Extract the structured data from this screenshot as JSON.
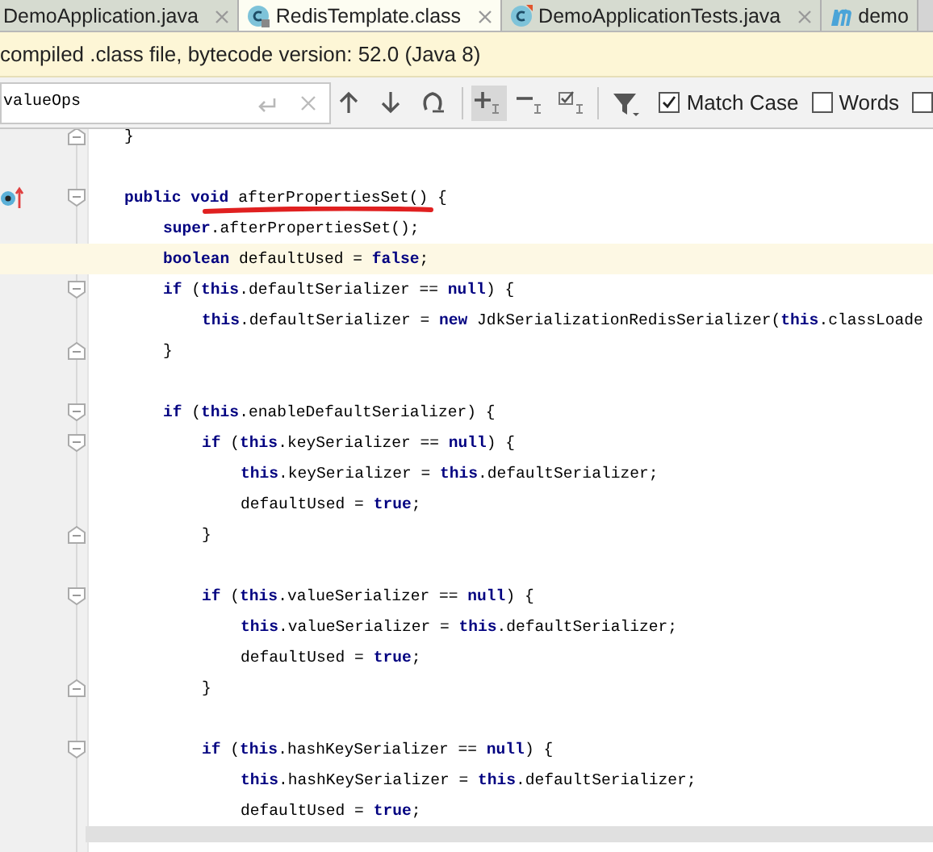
{
  "tabs": [
    {
      "label": "DemoApplication.java",
      "kind": "plain",
      "selected": false,
      "closable": true
    },
    {
      "label": "RedisTemplate.class",
      "kind": "class",
      "selected": true,
      "closable": true
    },
    {
      "label": "DemoApplicationTests.java",
      "kind": "test",
      "selected": false,
      "closable": true
    },
    {
      "label": "demo",
      "kind": "maven",
      "selected": false,
      "closable": false
    }
  ],
  "banner": {
    "text": "compiled .class file, bytecode version: 52.0 (Java 8)"
  },
  "find_bar": {
    "value": "valueOps",
    "tools": [
      {
        "kind": "up",
        "selected": false
      },
      {
        "kind": "down",
        "selected": false
      },
      {
        "kind": "find-all",
        "selected": false
      },
      {
        "kind": "add-occurrence",
        "selected": true
      },
      {
        "kind": "remove-occurrence",
        "selected": false
      },
      {
        "kind": "select-all",
        "selected": false
      },
      {
        "kind": "filter",
        "selected": false
      }
    ],
    "options": [
      {
        "label": "Match Case",
        "checked": true
      },
      {
        "label": "Words",
        "checked": false
      },
      {
        "checked": false
      }
    ]
  },
  "code": [
    {
      "kind": "block-end",
      "tokens": [
        {
          "text": "}",
          "kind": "plain"
        }
      ]
    },
    {
      "kind": "blank"
    },
    {
      "kind": "block-start",
      "overrides": true,
      "tokens": [
        {
          "text": "public",
          "kind": "keyword"
        },
        {
          "text": " void",
          "kind": "keyword"
        },
        {
          "text": " afterPropertiesSet() {",
          "kind": "plain"
        }
      ],
      "children": [
        {
          "kind": "statement",
          "tokens": [
            {
              "text": "super",
              "kind": "keyword"
            },
            {
              "text": ".afterPropertiesSet();",
              "kind": "plain"
            }
          ]
        },
        {
          "kind": "statement",
          "current": true,
          "tokens": [
            {
              "text": "boolean",
              "kind": "keyword"
            },
            {
              "text": " defaultUsed = ",
              "kind": "plain"
            },
            {
              "text": "false",
              "kind": "keyword"
            },
            {
              "text": ";",
              "kind": "plain"
            }
          ]
        },
        {
          "kind": "block-start",
          "tokens": [
            {
              "text": "if",
              "kind": "keyword"
            },
            {
              "text": " (",
              "kind": "plain"
            },
            {
              "text": "this",
              "kind": "keyword"
            },
            {
              "text": ".defaultSerializer == ",
              "kind": "plain"
            },
            {
              "text": "null",
              "kind": "keyword"
            },
            {
              "text": ") {",
              "kind": "plain"
            }
          ],
          "children": [
            {
              "kind": "statement",
              "tokens": [
                {
                  "text": "this",
                  "kind": "keyword"
                },
                {
                  "text": ".defaultSerializer = ",
                  "kind": "plain"
                },
                {
                  "text": "new",
                  "kind": "keyword"
                },
                {
                  "text": " JdkSerializationRedisSerializer(",
                  "kind": "plain"
                },
                {
                  "text": "this",
                  "kind": "keyword"
                },
                {
                  "text": ".classLoade",
                  "kind": "plain"
                }
              ]
            }
          ]
        },
        {
          "kind": "block-end",
          "tokens": [
            {
              "text": "}",
              "kind": "plain"
            }
          ]
        },
        {
          "kind": "blank"
        },
        {
          "kind": "block-start",
          "tokens": [
            {
              "text": "if",
              "kind": "keyword"
            },
            {
              "text": " (",
              "kind": "plain"
            },
            {
              "text": "this",
              "kind": "keyword"
            },
            {
              "text": ".enableDefaultSerializer) {",
              "kind": "plain"
            }
          ],
          "children": [
            {
              "kind": "block-start",
              "tokens": [
                {
                  "text": "if",
                  "kind": "keyword"
                },
                {
                  "text": " (",
                  "kind": "plain"
                },
                {
                  "text": "this",
                  "kind": "keyword"
                },
                {
                  "text": ".keySerializer == ",
                  "kind": "plain"
                },
                {
                  "text": "null",
                  "kind": "keyword"
                },
                {
                  "text": ") {",
                  "kind": "plain"
                }
              ],
              "children": [
                {
                  "kind": "statement",
                  "tokens": [
                    {
                      "text": "this",
                      "kind": "keyword"
                    },
                    {
                      "text": ".keySerializer = ",
                      "kind": "plain"
                    },
                    {
                      "text": "this",
                      "kind": "keyword"
                    },
                    {
                      "text": ".defaultSerializer;",
                      "kind": "plain"
                    }
                  ]
                },
                {
                  "kind": "statement",
                  "tokens": [
                    {
                      "text": "defaultUsed = ",
                      "kind": "plain"
                    },
                    {
                      "text": "true",
                      "kind": "keyword"
                    },
                    {
                      "text": ";",
                      "kind": "plain"
                    }
                  ]
                }
              ]
            },
            {
              "kind": "block-end",
              "tokens": [
                {
                  "text": "}",
                  "kind": "plain"
                }
              ]
            },
            {
              "kind": "blank"
            },
            {
              "kind": "block-start",
              "tokens": [
                {
                  "text": "if",
                  "kind": "keyword"
                },
                {
                  "text": " (",
                  "kind": "plain"
                },
                {
                  "text": "this",
                  "kind": "keyword"
                },
                {
                  "text": ".valueSerializer == ",
                  "kind": "plain"
                },
                {
                  "text": "null",
                  "kind": "keyword"
                },
                {
                  "text": ") {",
                  "kind": "plain"
                }
              ],
              "children": [
                {
                  "kind": "statement",
                  "tokens": [
                    {
                      "text": "this",
                      "kind": "keyword"
                    },
                    {
                      "text": ".valueSerializer = ",
                      "kind": "plain"
                    },
                    {
                      "text": "this",
                      "kind": "keyword"
                    },
                    {
                      "text": ".defaultSerializer;",
                      "kind": "plain"
                    }
                  ]
                },
                {
                  "kind": "statement",
                  "tokens": [
                    {
                      "text": "defaultUsed = ",
                      "kind": "plain"
                    },
                    {
                      "text": "true",
                      "kind": "keyword"
                    },
                    {
                      "text": ";",
                      "kind": "plain"
                    }
                  ]
                }
              ]
            },
            {
              "kind": "block-end",
              "tokens": [
                {
                  "text": "}",
                  "kind": "plain"
                }
              ]
            },
            {
              "kind": "blank"
            },
            {
              "kind": "block-start",
              "tokens": [
                {
                  "text": "if",
                  "kind": "keyword"
                },
                {
                  "text": " (",
                  "kind": "plain"
                },
                {
                  "text": "this",
                  "kind": "keyword"
                },
                {
                  "text": ".hashKeySerializer == ",
                  "kind": "plain"
                },
                {
                  "text": "null",
                  "kind": "keyword"
                },
                {
                  "text": ") {",
                  "kind": "plain"
                }
              ],
              "children": [
                {
                  "kind": "statement",
                  "tokens": [
                    {
                      "text": "this",
                      "kind": "keyword"
                    },
                    {
                      "text": ".hashKeySerializer = ",
                      "kind": "plain"
                    },
                    {
                      "text": "this",
                      "kind": "keyword"
                    },
                    {
                      "text": ".defaultSerializer;",
                      "kind": "plain"
                    }
                  ]
                },
                {
                  "kind": "statement",
                  "tokens": [
                    {
                      "text": "defaultUsed = ",
                      "kind": "plain"
                    },
                    {
                      "text": "true",
                      "kind": "keyword"
                    },
                    {
                      "text": ";",
                      "kind": "plain"
                    }
                  ]
                }
              ]
            }
          ]
        }
      ]
    }
  ]
}
